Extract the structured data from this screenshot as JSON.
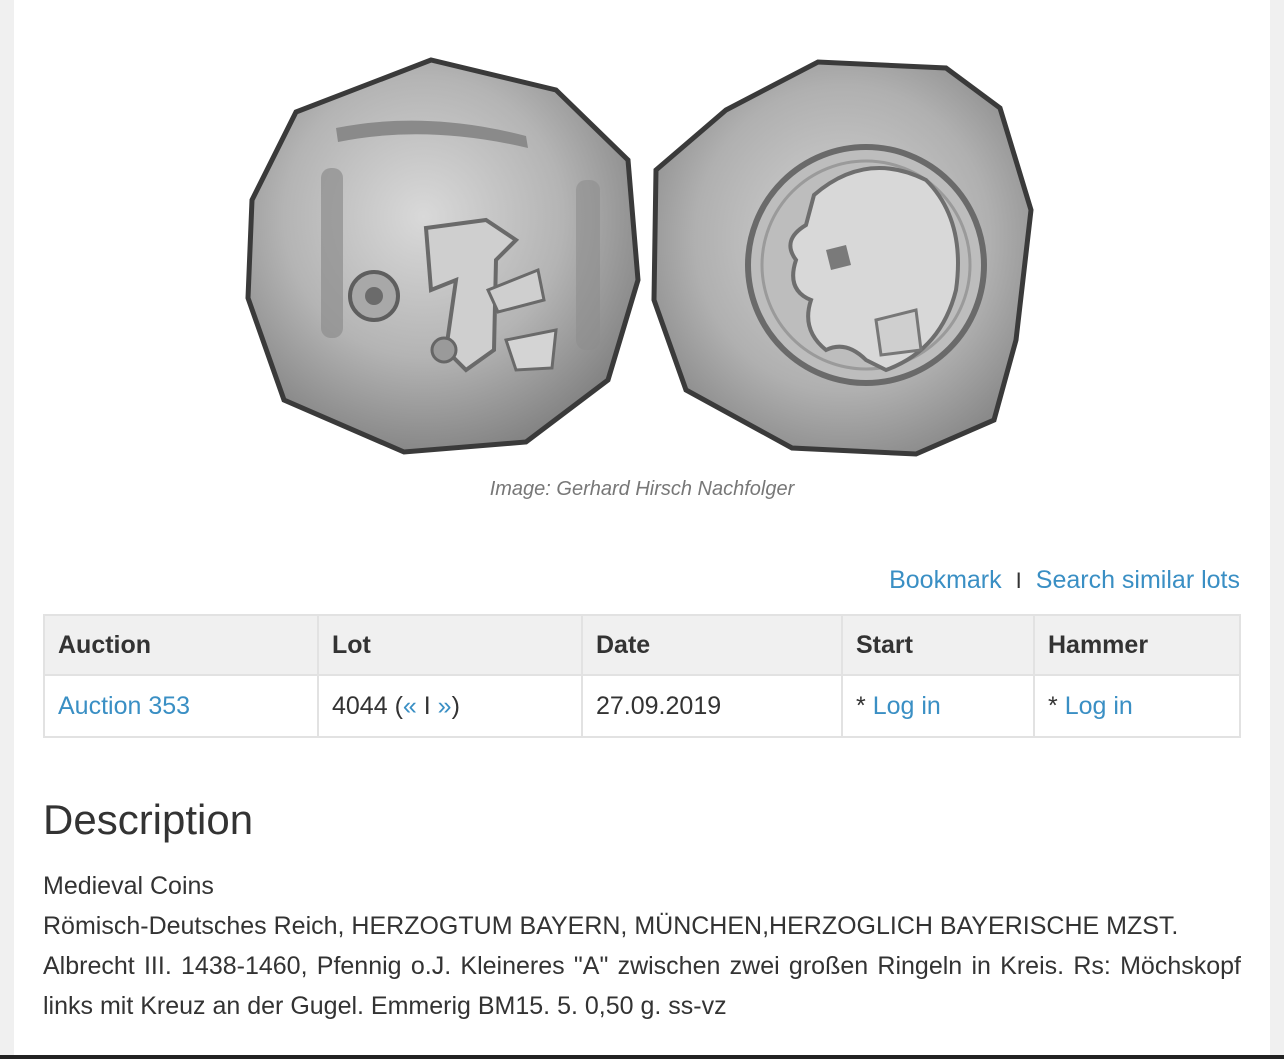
{
  "image": {
    "caption": "Image: Gerhard Hirsch Nachfolger",
    "obverse_icon": "coin-obverse-icon",
    "reverse_icon": "coin-reverse-icon"
  },
  "actions": {
    "bookmark": "Bookmark",
    "separator": "I",
    "search_similar": "Search similar lots"
  },
  "table": {
    "headers": [
      "Auction",
      "Lot",
      "Date",
      "Start",
      "Hammer"
    ],
    "row": {
      "auction": "Auction 353",
      "lot_number": "4044",
      "lot_open": " (",
      "prev": "«",
      "lot_sep": " I ",
      "next": "»",
      "lot_close": ")",
      "date": "27.09.2019",
      "start_prefix": "* ",
      "start_link": "Log in",
      "hammer_prefix": "* ",
      "hammer_link": "Log in"
    }
  },
  "description": {
    "title": "Description",
    "category": "Medieval Coins",
    "line1": "Römisch-Deutsches Reich, HERZOGTUM BAYERN, MÜNCHEN,HERZOGLICH BAYERISCHE MZST.",
    "line2": "Albrecht III. 1438-1460, Pfennig o.J. Kleineres \"A\" zwischen zwei großen Ringeln in Kreis. Rs: Möchskopf links mit Kreuz an der Gugel. Emmerig BM15. 5. 0,50 g. ss-vz"
  },
  "colors": {
    "link": "#3a8fc4",
    "caption": "#777777",
    "header_bg": "#f0f0f0",
    "border": "#e2e2e2"
  }
}
